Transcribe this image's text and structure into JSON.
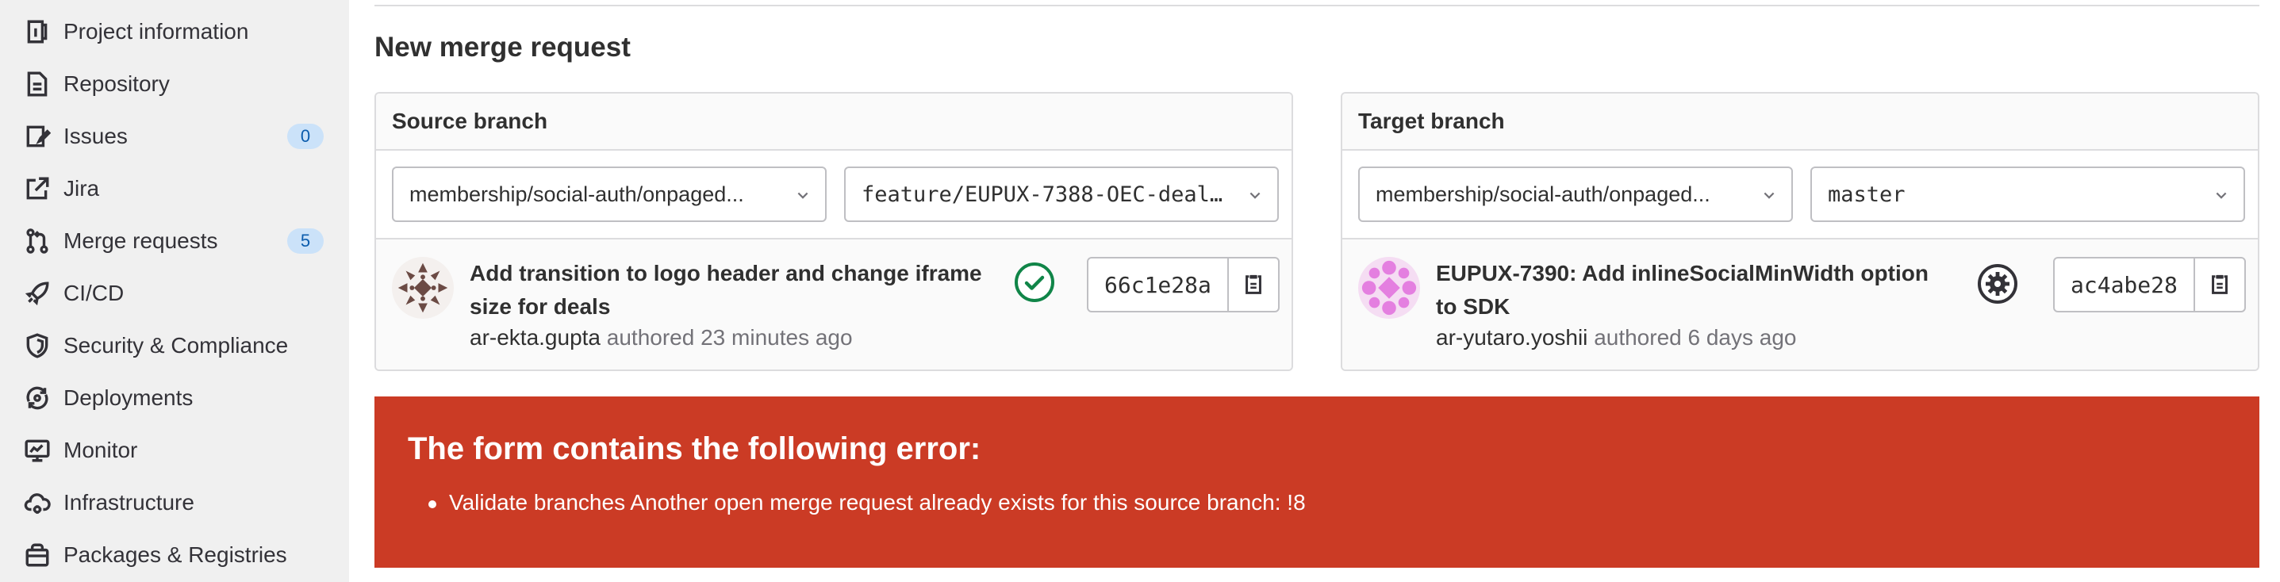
{
  "sidebar": {
    "items": [
      {
        "label": "Project information",
        "icon": "project-info-icon"
      },
      {
        "label": "Repository",
        "icon": "document-icon"
      },
      {
        "label": "Issues",
        "icon": "issues-icon",
        "badge": "0"
      },
      {
        "label": "Jira",
        "icon": "external-link-icon"
      },
      {
        "label": "Merge requests",
        "icon": "merge-request-icon",
        "badge": "5"
      },
      {
        "label": "CI/CD",
        "icon": "rocket-icon"
      },
      {
        "label": "Security & Compliance",
        "icon": "shield-icon"
      },
      {
        "label": "Deployments",
        "icon": "deployments-icon"
      },
      {
        "label": "Monitor",
        "icon": "monitor-icon"
      },
      {
        "label": "Infrastructure",
        "icon": "cloud-gear-icon"
      },
      {
        "label": "Packages & Registries",
        "icon": "package-icon"
      }
    ]
  },
  "page": {
    "title": "New merge request"
  },
  "source": {
    "heading": "Source branch",
    "project": "membership/social-auth/onpaged...",
    "branch": "feature/EUPUX-7388-OEC-deal...",
    "commit_title": "Add transition to logo header and change iframe size for deals",
    "author": "ar-ekta.gupta",
    "authored_text": "authored 23 minutes ago",
    "sha": "66c1e28a",
    "status_icon": "status-success-icon",
    "status_color": "#108548"
  },
  "target": {
    "heading": "Target branch",
    "project": "membership/social-auth/onpaged...",
    "branch": "master",
    "commit_title": "EUPUX-7390: Add inlineSocialMinWidth option to SDK",
    "author": "ar-yutaro.yoshii",
    "authored_text": "authored 6 days ago",
    "sha": "ac4abe28",
    "status_icon": "status-settings-icon",
    "status_color": "#333238"
  },
  "error": {
    "title": "The form contains the following error:",
    "messages": [
      "Validate branches Another open merge request already exists for this source branch: !8"
    ],
    "color": "#cb3b25"
  }
}
